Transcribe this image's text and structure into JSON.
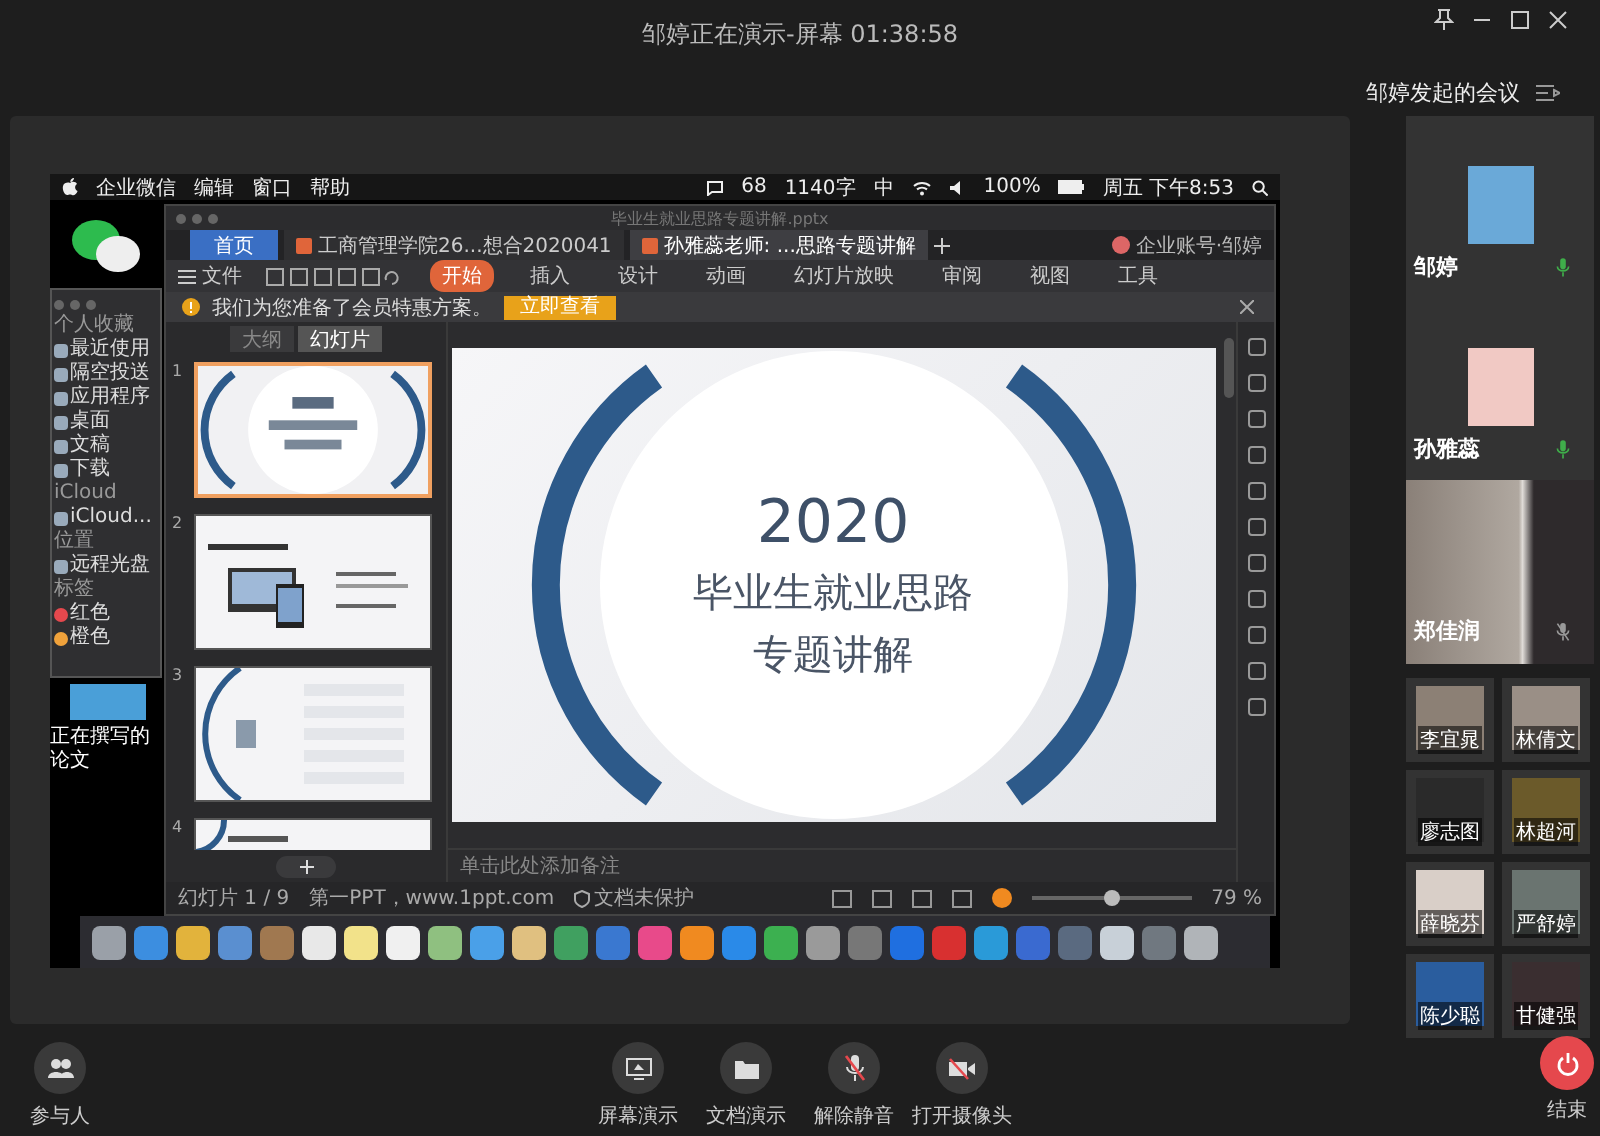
{
  "window": {
    "title": "邹婷正在演示-屏幕 01:38:58"
  },
  "meeting_panel": {
    "title": "邹婷发起的会议",
    "featured": [
      {
        "name": "邹婷",
        "kind": "avatar",
        "muted": false
      },
      {
        "name": "孙雅蕊",
        "kind": "avatar",
        "muted": false
      },
      {
        "name": "郑佳润",
        "kind": "video",
        "muted": true
      }
    ],
    "participants": [
      {
        "name": "李宜晁"
      },
      {
        "name": "林倩文"
      },
      {
        "name": "廖志图"
      },
      {
        "name": "林超河"
      },
      {
        "name": "薛晓芬"
      },
      {
        "name": "严舒婷"
      },
      {
        "name": "陈少聪"
      },
      {
        "name": "甘健强"
      }
    ]
  },
  "shared_screen": {
    "menu_bar": {
      "menus": [
        "企业微信",
        "编辑",
        "窗口",
        "帮助"
      ],
      "status": [
        "68",
        "1140字",
        "中",
        "100%",
        "周五 下午8:53"
      ]
    },
    "finder_sidebar": {
      "sections": [
        {
          "title": "个人收藏",
          "items": [
            {
              "label": "最近使用"
            },
            {
              "label": "隔空投送"
            },
            {
              "label": "应用程序"
            },
            {
              "label": "桌面"
            },
            {
              "label": "文稿"
            },
            {
              "label": "下载"
            }
          ]
        },
        {
          "title": "iCloud",
          "items": [
            {
              "label": "iCloud..."
            }
          ]
        },
        {
          "title": "位置",
          "items": [
            {
              "label": "远程光盘"
            }
          ]
        },
        {
          "title": "标签",
          "items": [
            {
              "label": "红色",
              "color": "#e5484d"
            },
            {
              "label": "橙色",
              "color": "#f0a23b"
            }
          ]
        }
      ]
    },
    "desktop_file": {
      "name": "正在撰写的论文"
    },
    "wps": {
      "title": "毕业生就业思路专题讲解.pptx",
      "tabs": [
        {
          "label": "首页",
          "kind": "home",
          "selected": false
        },
        {
          "label": "工商管理学院26...想合2020041",
          "kind": "doc",
          "selected": false
        },
        {
          "label": "孙雅蕊老师: ...思路专题讲解",
          "kind": "doc",
          "selected": true
        }
      ],
      "account": "企业账号·邹婷",
      "file_menu": "文件",
      "ribbon_tabs": [
        {
          "label": "开始",
          "selected": true
        },
        {
          "label": "插入",
          "selected": false
        },
        {
          "label": "设计",
          "selected": false
        },
        {
          "label": "动画",
          "selected": false
        },
        {
          "label": "幻灯片放映",
          "selected": false
        },
        {
          "label": "审阅",
          "selected": false
        },
        {
          "label": "视图",
          "selected": false
        },
        {
          "label": "工具",
          "selected": false
        }
      ],
      "notice": {
        "text": "我们为您准备了会员特惠方案。",
        "button": "立即查看"
      },
      "panel_tabs": [
        {
          "label": "大纲",
          "selected": false
        },
        {
          "label": "幻灯片",
          "selected": true
        }
      ],
      "thumbnails": [
        {
          "number": "1",
          "kind": "title",
          "selected": true
        },
        {
          "number": "2",
          "kind": "picture",
          "selected": false
        },
        {
          "number": "3",
          "kind": "contents",
          "selected": false
        },
        {
          "number": "4",
          "kind": "section",
          "selected": false
        }
      ],
      "slide": {
        "year": "2020",
        "title": "毕业生就业思路",
        "subtitle": "专题讲解"
      },
      "notes_placeholder": "单击此处添加备注",
      "status_bar": {
        "slide_count": "幻灯片 1 / 9",
        "theme": "第一PPT，www.1ppt.com",
        "protection": "文档未保护",
        "zoom": "79 %",
        "zoom_level": {
          "level": 0.5
        }
      }
    }
  },
  "toolbar": {
    "participants": "参与人",
    "actions": [
      {
        "label": "屏幕演示",
        "kind": "screen"
      },
      {
        "label": "文档演示",
        "kind": "document"
      },
      {
        "label": "解除静音",
        "kind": "unmute"
      },
      {
        "label": "打开摄像头",
        "kind": "camera"
      }
    ],
    "end": "结束"
  }
}
